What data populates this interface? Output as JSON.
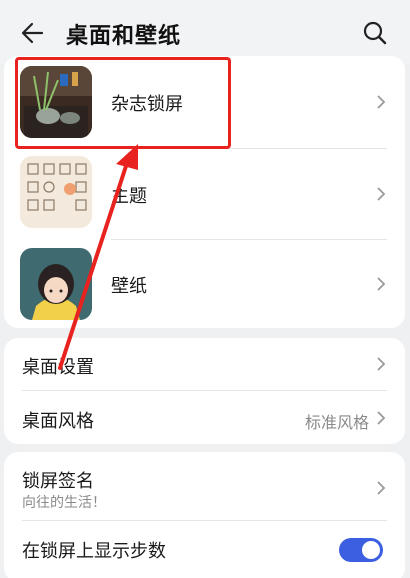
{
  "header": {
    "title": "桌面和壁纸",
    "back_icon": "arrow-left-icon",
    "search_icon": "search-icon"
  },
  "themes_card": {
    "items": [
      {
        "label": "杂志锁屏",
        "thumbnail": "magazine-lock-screen-thumbnail"
      },
      {
        "label": "主题",
        "thumbnail": "theme-thumbnail"
      },
      {
        "label": "壁纸",
        "thumbnail": "wallpaper-thumbnail"
      }
    ]
  },
  "desktop_card": {
    "items": [
      {
        "label": "桌面设置",
        "value": ""
      },
      {
        "label": "桌面风格",
        "value": "标准风格"
      }
    ]
  },
  "lock_card": {
    "signature_label": "锁屏签名",
    "signature_value": "向往的生活！",
    "steps_label": "在锁屏上显示步数",
    "steps_enabled": true
  },
  "annotation": {
    "color": "#e8221e"
  },
  "colors": {
    "accent": "#3b5fe0",
    "background": "#eef0f2"
  }
}
